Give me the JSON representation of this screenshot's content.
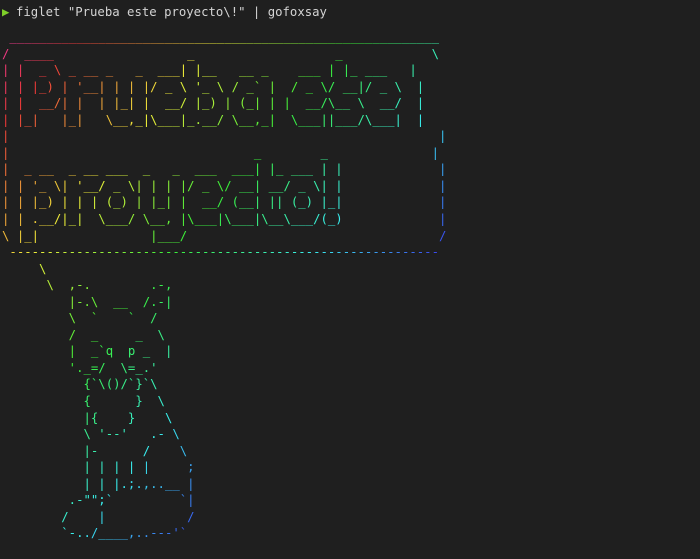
{
  "terminal": {
    "prompt_symbol": "▶",
    "command": "figlet \"Prueba este proyecto\\!\" | gofoxsay",
    "colors": {
      "background": "#1f1f1f",
      "prompt": "#7fd02a",
      "text": "#d4d4d4"
    }
  },
  "output_lines": [
    " __________________________________________________________",
    "/  ____                  _                   _            \\",
    "| |  _ \\ _ __ _   _  ___| |__   __ _    ___ | |_ ___   |",
    "| | |_) | '__| | | |/ _ \\ '_ \\ / _` |  / _ \\/ __|/ _ \\  |",
    "| |  __/| |  | |_| |  __/ |_) | (_| | |  __/\\__ \\  __/  |",
    "| |_|   |_|   \\__,_|\\___|_.__/ \\__,_|  \\___||___/\\___|  |",
    "|                                                          |",
    "|                                 _        _              |",
    "|  _ __  _ __ ___  _   _  ___  ___| |_ ___ | |             |",
    "| | '_ \\| '__/ _ \\| | | |/ _ \\/ __| __/ _ \\| |             |",
    "| | |_) | | | (_) | |_| |  __/ (__| || (_) |_|             |",
    "| | .__/|_|  \\___/ \\__, |\\___|\\___|\\__\\___/(_)             |",
    "\\ |_|               |___/                                  /",
    " ----------------------------------------------------------",
    "     \\",
    "      \\  ,-.        .-,",
    "         |-.\\  __  /.-|",
    "         \\  `    `  /",
    "         /  _     _  \\",
    "         |  _`q  p _  |",
    "         '._=/  \\=_.'",
    "           {`\\()/`}`\\",
    "           {      }  \\",
    "           |{    }    \\",
    "           \\ '--'   .- \\",
    "           |-      /    \\",
    "           | | | | |     ;",
    "           | | |.;.,..__ |",
    "         .-\"\";`         `|",
    "        /    |           /",
    "        `-../____,..---'`"
  ]
}
